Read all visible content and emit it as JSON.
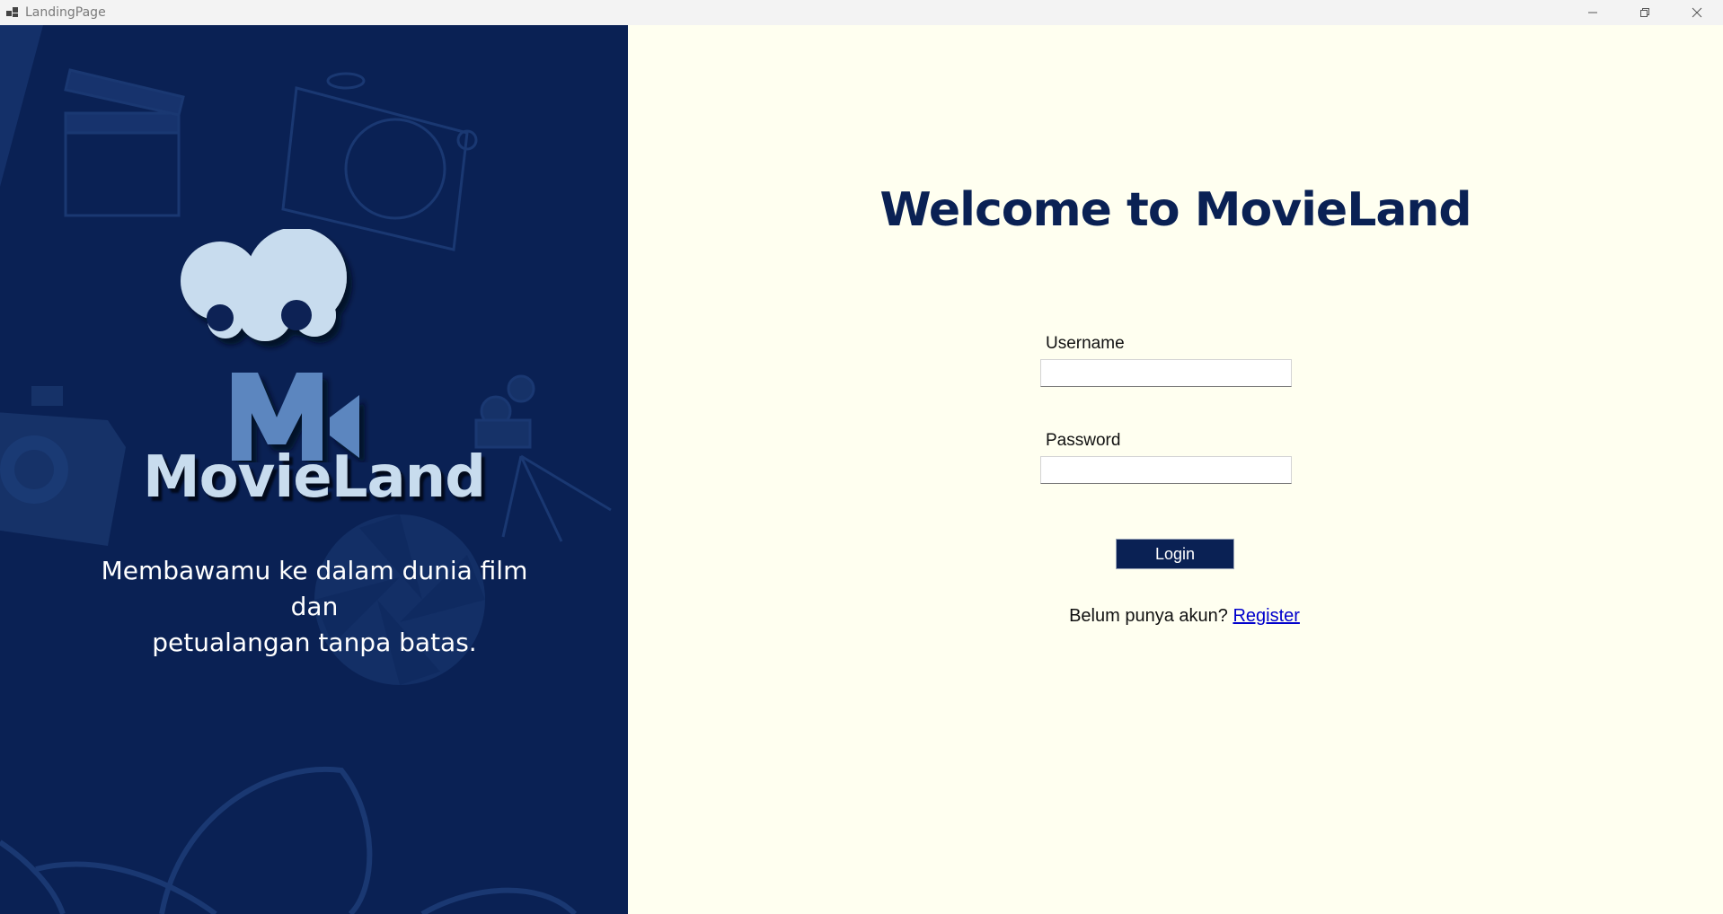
{
  "window": {
    "title": "LandingPage",
    "app_icon": "app-window-icon",
    "controls": [
      "minimize-icon",
      "restore-icon",
      "close-icon"
    ]
  },
  "left": {
    "brand": "MovieLand",
    "tagline_line1": "Membawamu ke dalam dunia film dan",
    "tagline_line2": "petualangan tanpa batas.",
    "background_icons": [
      "clapperboard-icon",
      "camera-icon",
      "film-projector-icon",
      "aperture-icon",
      "film-reel-icon"
    ]
  },
  "right": {
    "welcome": "Welcome to MovieLand",
    "username_label": "Username",
    "username_value": "",
    "password_label": "Password",
    "password_value": "",
    "login_label": "Login",
    "register_prompt": "Belum punya akun?",
    "register_link": "Register"
  },
  "colors": {
    "navy": "#0a2154",
    "cream": "#fffff0",
    "logo_light": "#c8dcee",
    "logo_mid": "#5b86bf",
    "link": "#0000cc"
  }
}
